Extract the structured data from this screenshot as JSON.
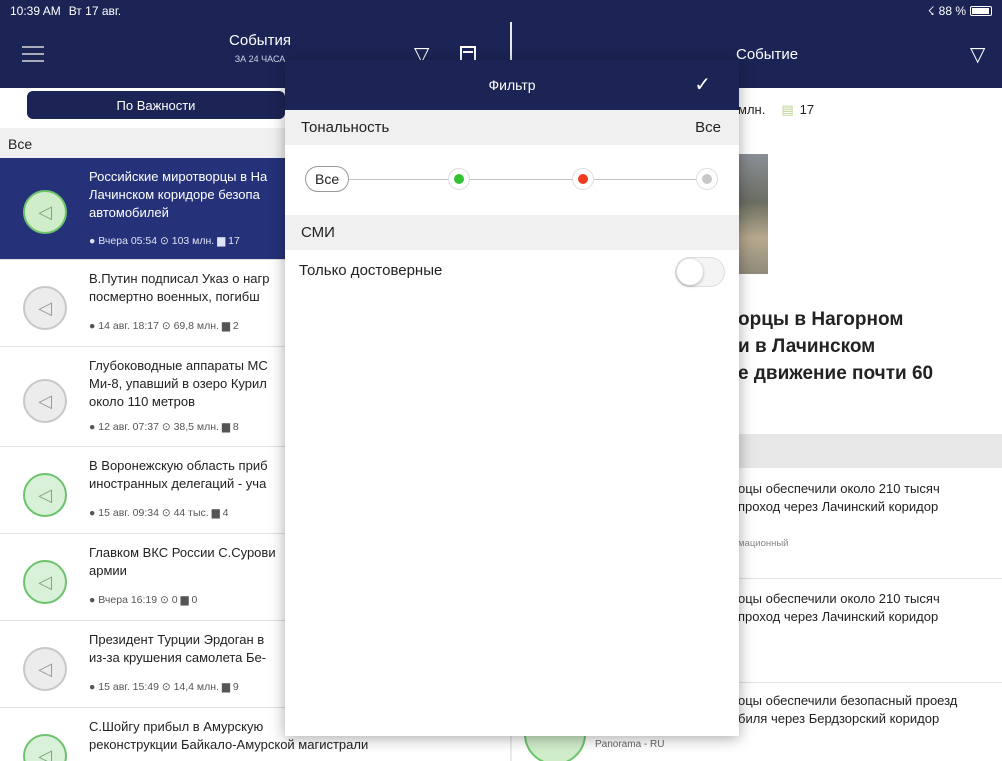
{
  "status_bar": {
    "time": "10:39 AM",
    "date": "Вт 17 авг.",
    "battery": "88 %"
  },
  "left_header": {
    "title": "События",
    "subtitle": "ЗА 24 ЧАСА"
  },
  "right_header": {
    "title": "Событие"
  },
  "segment": {
    "active_label": "По Важности"
  },
  "section": {
    "label": "Все"
  },
  "news": [
    {
      "text": "Российские миротворцы в На",
      "text2": "Лачинском коридоре безопа",
      "text3": "автомобилей",
      "meta": "● Вчера 05:54   ⊙ 103 млн.   ▆ 17"
    },
    {
      "text": "В.Путин подписал Указ о нагр",
      "text2": "посмертно военных, погибш",
      "meta": "● 14 авг. 18:17   ⊙ 69,8 млн.   ▆ 2"
    },
    {
      "text": "Глубоководные аппараты МС",
      "text2": "Ми-8, упавший в озеро Курил",
      "text3": "около 110 метров",
      "meta": "● 12 авг. 07:37   ⊙ 38,5 млн.   ▆ 8"
    },
    {
      "text": "В Воронежскую область приб",
      "text2": "иностранных делегаций - уча",
      "meta": "● 15 авг. 09:34   ⊙ 44 тыс.   ▆ 4"
    },
    {
      "text": "Главком ВКС России С.Сурови",
      "text2": "армии",
      "meta": "● Вчера 16:19   ⊙ 0   ▆ 0"
    },
    {
      "text": "Президент Турции Эрдоган в",
      "text2": "из-за крушения самолета Бе-",
      "meta": "● 15 авг. 15:49   ⊙ 14,4 млн.   ▆ 9"
    },
    {
      "text": "С.Шойгу прибыл в Амурскую",
      "text2": "реконструкции Байкало-Амурской магистрали"
    }
  ],
  "right_panel": {
    "stats_views": "млн.",
    "stats_comments": "17",
    "headline": "орцы в Нагорном\nи в Лачинском\nе движение почти 60",
    "item1": "оцы обеспечили около 210 тысяч\nпроход через Лачинский коридор",
    "item1_tag": "мационный",
    "item2": "оцы обеспечили около 210 тысяч\nпроход через Лачинский коридор",
    "item3": "оцы обеспечили безопасный проезд\nбиля через Бердзорский коридор",
    "source": "Panorama - RU"
  },
  "filter": {
    "title": "Фильтр",
    "tonality_label": "Тональность",
    "tonality_value": "Все",
    "all_pill": "Все",
    "dot_colors": [
      "#33c233",
      "#f03c1e",
      "#c8c8c8"
    ],
    "media_label": "СМИ",
    "only_reliable_label": "Только достоверные",
    "only_reliable_on": false
  }
}
